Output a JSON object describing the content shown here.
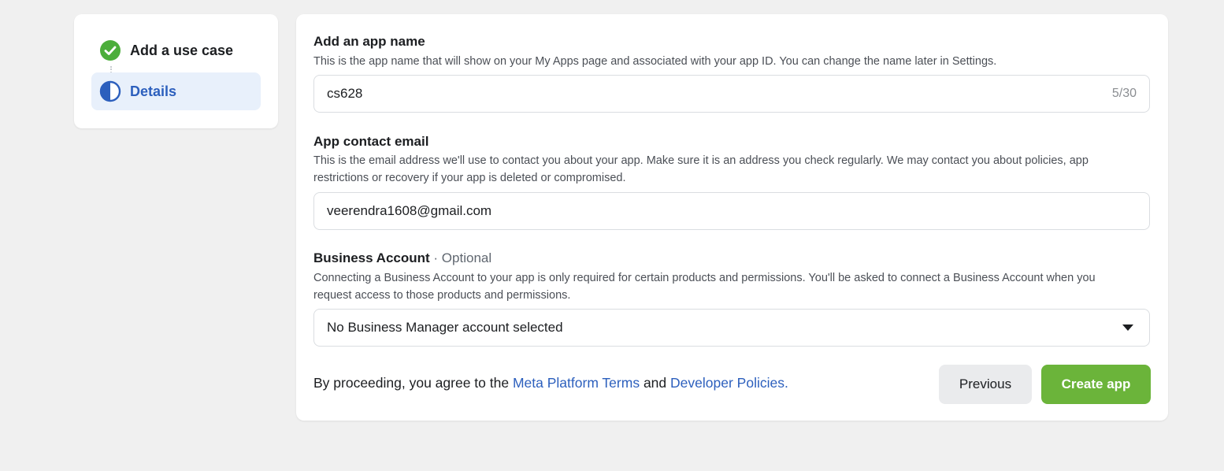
{
  "steps": [
    {
      "label": "Add a use case",
      "status": "done"
    },
    {
      "label": "Details",
      "status": "active"
    }
  ],
  "colors": {
    "accent_blue": "#2c5fbd",
    "success_green": "#4cae3b",
    "create_button": "#6bb43a"
  },
  "app_name": {
    "label": "Add an app name",
    "help": "This is the app name that will show on your My Apps page and associated with your app ID. You can change the name later in Settings.",
    "value": "cs628",
    "counter": "5/30"
  },
  "contact_email": {
    "label": "App contact email",
    "help": "This is the email address we'll use to contact you about your app. Make sure it is an address you check regularly. We may contact you about policies, app restrictions or recovery if your app is deleted or compromised.",
    "value": "veerendra1608@gmail.com"
  },
  "business_account": {
    "label": "Business Account",
    "optional": "· Optional",
    "help": "Connecting a Business Account to your app is only required for certain products and permissions. You'll be asked to connect a Business Account when you request access to those products and permissions.",
    "selected": "No Business Manager account selected"
  },
  "footer": {
    "terms_prefix": "By proceeding, you agree to the",
    "terms_link1": "Meta Platform Terms",
    "terms_and": "and",
    "terms_link2": "Developer Policies.",
    "previous_label": "Previous",
    "create_label": "Create app"
  }
}
